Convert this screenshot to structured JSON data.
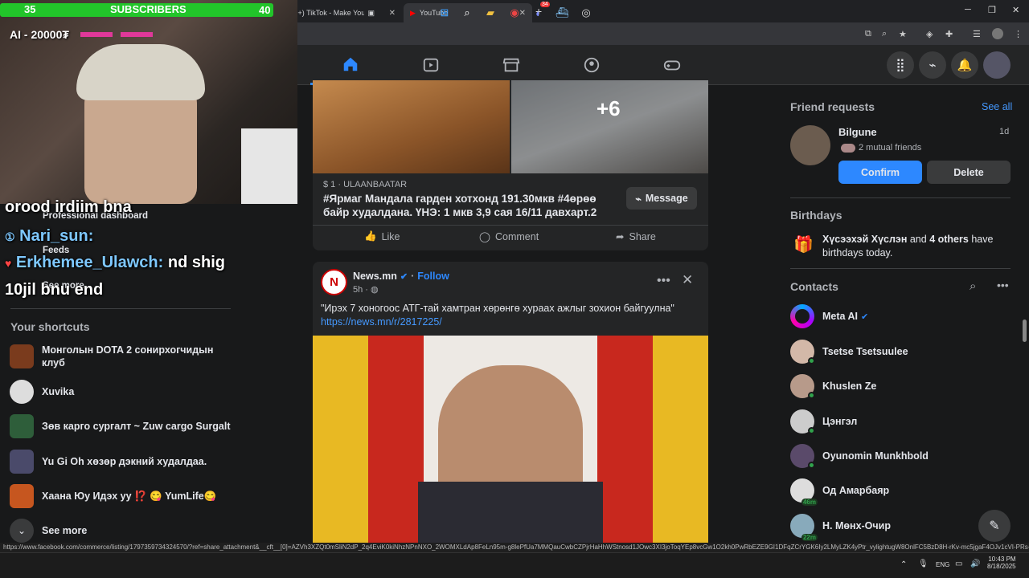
{
  "browser": {
    "tabs": [
      {
        "label": "(99+) TikTok - Make Your Day"
      },
      {
        "label": "YouTube"
      }
    ],
    "new_tab": "+",
    "close": "✕",
    "status_url": "https://www.facebook.com/commerce/listing/1797359734324570/?ref=share_attachment&__cft__[0]=AZVh3XZQt0mSliN2dP_2q4EviK0kiNhzNPnNXO_2WOMXLdAp8FeLn95m-g8lePfUa7MMQauCwbCZPjrHaHhWStnosd1JOwc3XI3joToqYEp8vcGw1O2kh0PwRbEZE9GI1DFqZCrYGK6Iy2LMyLZK4yPtr_vylightugW8OnlFC5BzD8H-rKv-mc5jgaF4OJv1cVI-PRs-C..."
  },
  "stream_overlay": {
    "sub_left": "35",
    "sub_label": "SUBSCRIBERS",
    "sub_right": "40",
    "ai_label": "AI - 20000₮",
    "chat": [
      {
        "name": "",
        "text": "orood irdiim bna"
      },
      {
        "name": "Nari_sun:",
        "text": ""
      },
      {
        "name": "Erkhemee_Ulawch:",
        "text": "nd shig"
      },
      {
        "name": "",
        "text": "10jil bnu end"
      }
    ]
  },
  "left_sidebar": {
    "items_top": [
      {
        "label": "Professional dashboard"
      },
      {
        "label": "Feeds"
      },
      {
        "label": "See more"
      }
    ],
    "shortcuts_title": "Your shortcuts",
    "shortcuts": [
      {
        "label": "Монголын DOTA 2 сонирхогчидын клуб",
        "color": "#7a3b1d"
      },
      {
        "label": "Xuvika",
        "color": "#ddd"
      },
      {
        "label": "Зөв карго сургалт ~ Zuw cargo Surgalt",
        "color": "#2e5e3a"
      },
      {
        "label": "Yu Gi Oh хөзөр дэкний худалдаа.",
        "color": "#4a4a6a"
      },
      {
        "label": "Хаана Юу Идэх уу ⁉️ 😋 YumLife😋",
        "color": "#c6561f"
      }
    ],
    "see_more": "See more"
  },
  "feed": {
    "listing": {
      "more_count": "+6",
      "meta": "$ 1 · ULAANBAATAR",
      "title": "#Ярмаг Мандала гарден хотхонд 191.30мкв #4өрөө байр худалдана. ҮНЭ: 1 мкв 3,9 сая 16/11 давхарт.2",
      "message_btn": "Message",
      "like": "Like",
      "comment": "Comment",
      "share": "Share"
    },
    "post": {
      "page": "News.mn",
      "follow": "Follow",
      "time": "5h",
      "text": "\"Ирэх 7 хоногоос АТГ-тай хамтран хөрөнгө хураах ажлыг зохион байгуулна\"",
      "link": "https://news.mn/r/2817225/",
      "avatar_letter": "N"
    }
  },
  "right_sidebar": {
    "friend_requests_title": "Friend requests",
    "see_all": "See all",
    "request": {
      "name": "Bilgune",
      "time": "1d",
      "mutual": "2 mutual friends",
      "confirm": "Confirm",
      "delete": "Delete"
    },
    "birthdays_title": "Birthdays",
    "birthday_name": "Хүсээхэй Хүслэн",
    "birthday_and": "and",
    "birthday_others": "4 others",
    "birthday_rest": "have birthdays today.",
    "contacts_title": "Contacts",
    "contacts": [
      {
        "name": "Meta AI",
        "online": false,
        "badge": ""
      },
      {
        "name": "Tsetse Tsetsuulee",
        "online": true,
        "badge": ""
      },
      {
        "name": "Khuslen Ze",
        "online": true,
        "badge": ""
      },
      {
        "name": "Цэнгэл",
        "online": true,
        "badge": ""
      },
      {
        "name": "Oyunomin Munkhbold",
        "online": true,
        "badge": ""
      },
      {
        "name": "Од Амарбаяр",
        "online": false,
        "badge": "46m"
      },
      {
        "name": "Н. Мөнх-Очир",
        "online": false,
        "badge": "22m"
      }
    ]
  },
  "taskbar": {
    "lang": "ENG",
    "time": "10:43 PM",
    "date": "8/18/2025",
    "badge": "34"
  },
  "colors": {
    "accent": "#2d88ff",
    "card": "#242526",
    "bg": "#18191a",
    "online": "#31a24c"
  }
}
